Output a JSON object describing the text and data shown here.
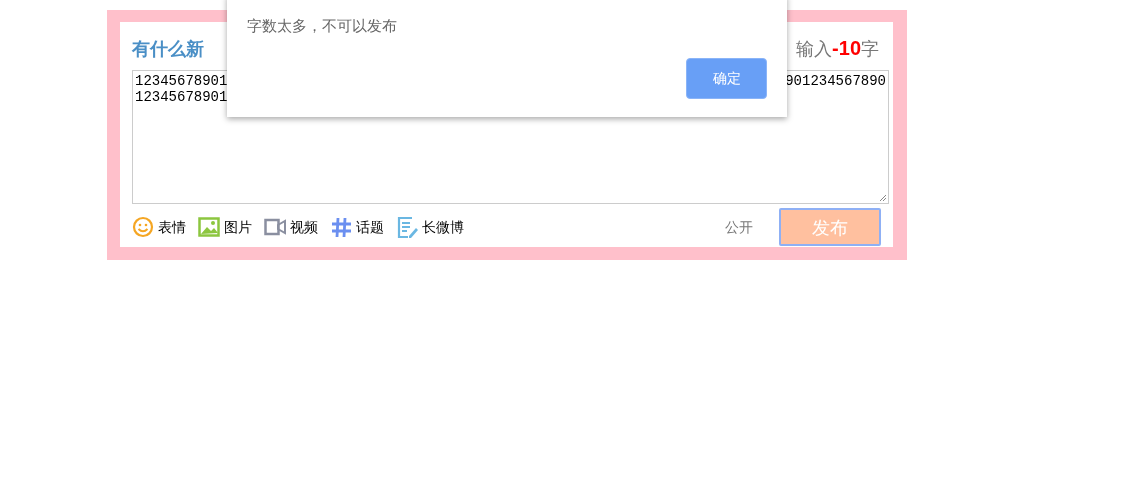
{
  "composer": {
    "title": "有什么新",
    "counter": {
      "prefix": "输入",
      "value": "-10",
      "suffix": "字"
    },
    "textarea": {
      "left_lines": [
        "12345678901",
        "12345678901"
      ],
      "right_lines": [
        "901234567890"
      ]
    },
    "tools": [
      {
        "kind": "emoji",
        "label": "表情"
      },
      {
        "kind": "image",
        "label": "图片"
      },
      {
        "kind": "video",
        "label": "视频"
      },
      {
        "kind": "topic",
        "label": "话题"
      },
      {
        "kind": "article",
        "label": "长微博"
      }
    ],
    "visibility": "公开",
    "publish_button": {
      "label": "发布",
      "disabled": true
    }
  },
  "dialog": {
    "message": "字数太多，不可以发布",
    "button": "确定"
  }
}
